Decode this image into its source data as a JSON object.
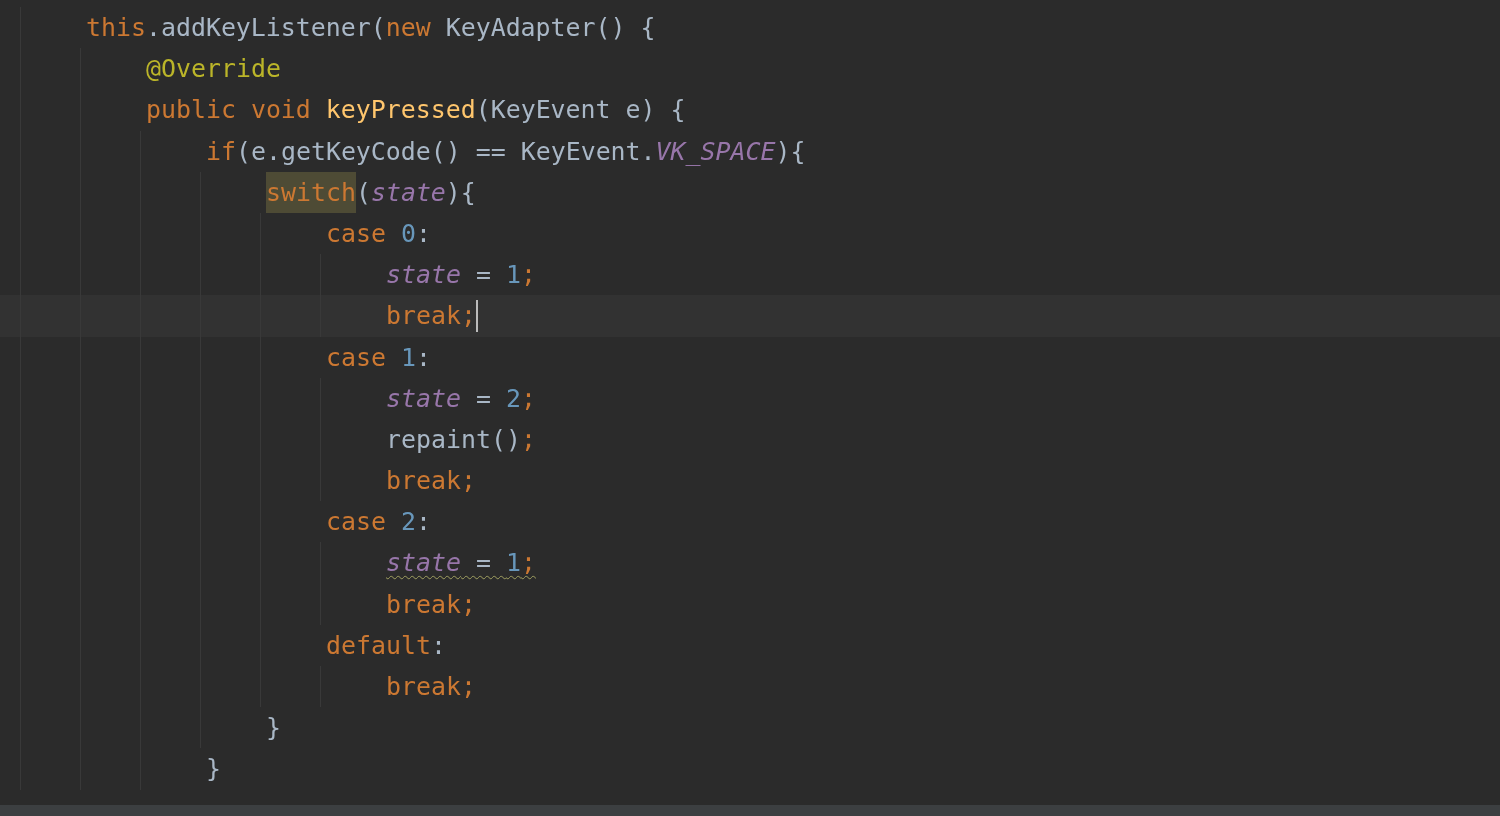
{
  "editor": {
    "lines": [
      {
        "current": false,
        "warning": false,
        "tokens": [
          {
            "kind": "keyword",
            "text": "this"
          },
          {
            "kind": "plain",
            "text": ".addKeyListener("
          },
          {
            "kind": "keyword",
            "text": "new"
          },
          {
            "kind": "plain",
            "text": " KeyAdapter() {"
          }
        ],
        "children": [
          {
            "current": false,
            "warning": false,
            "tokens": [
              {
                "kind": "annotation",
                "text": "@Override"
              }
            ]
          },
          {
            "current": false,
            "warning": false,
            "tokens": [
              {
                "kind": "keyword",
                "text": "public void "
              },
              {
                "kind": "method",
                "text": "keyPressed"
              },
              {
                "kind": "plain",
                "text": "(KeyEvent e) {"
              }
            ],
            "children": [
              {
                "current": false,
                "warning": false,
                "tokens": [
                  {
                    "kind": "keyword",
                    "text": "if"
                  },
                  {
                    "kind": "plain",
                    "text": "(e.getKeyCode() == KeyEvent."
                  },
                  {
                    "kind": "constant",
                    "text": "VK_SPACE"
                  },
                  {
                    "kind": "plain",
                    "text": "){"
                  }
                ],
                "children": [
                  {
                    "current": false,
                    "warning": false,
                    "tokens": [
                      {
                        "kind": "match",
                        "text": "switch"
                      },
                      {
                        "kind": "plain",
                        "text": "("
                      },
                      {
                        "kind": "field",
                        "text": "state"
                      },
                      {
                        "kind": "plain",
                        "text": "){"
                      }
                    ],
                    "children": [
                      {
                        "current": false,
                        "warning": false,
                        "tokens": [
                          {
                            "kind": "keyword",
                            "text": "case "
                          },
                          {
                            "kind": "number",
                            "text": "0"
                          },
                          {
                            "kind": "plain",
                            "text": ":"
                          }
                        ],
                        "children": [
                          {
                            "current": false,
                            "warning": false,
                            "tokens": [
                              {
                                "kind": "field",
                                "text": "state"
                              },
                              {
                                "kind": "plain",
                                "text": " = "
                              },
                              {
                                "kind": "number",
                                "text": "1"
                              },
                              {
                                "kind": "keyword",
                                "text": ";"
                              }
                            ]
                          },
                          {
                            "current": true,
                            "warning": false,
                            "tokens": [
                              {
                                "kind": "keyword",
                                "text": "break;"
                              }
                            ]
                          }
                        ]
                      },
                      {
                        "current": false,
                        "warning": false,
                        "tokens": [
                          {
                            "kind": "keyword",
                            "text": "case "
                          },
                          {
                            "kind": "number",
                            "text": "1"
                          },
                          {
                            "kind": "plain",
                            "text": ":"
                          }
                        ],
                        "children": [
                          {
                            "current": false,
                            "warning": false,
                            "tokens": [
                              {
                                "kind": "field",
                                "text": "state"
                              },
                              {
                                "kind": "plain",
                                "text": " = "
                              },
                              {
                                "kind": "number",
                                "text": "2"
                              },
                              {
                                "kind": "keyword",
                                "text": ";"
                              }
                            ]
                          },
                          {
                            "current": false,
                            "warning": false,
                            "tokens": [
                              {
                                "kind": "plain",
                                "text": "repaint()"
                              },
                              {
                                "kind": "keyword",
                                "text": ";"
                              }
                            ]
                          },
                          {
                            "current": false,
                            "warning": false,
                            "tokens": [
                              {
                                "kind": "keyword",
                                "text": "break;"
                              }
                            ]
                          }
                        ]
                      },
                      {
                        "current": false,
                        "warning": false,
                        "tokens": [
                          {
                            "kind": "keyword",
                            "text": "case "
                          },
                          {
                            "kind": "number",
                            "text": "2"
                          },
                          {
                            "kind": "plain",
                            "text": ":"
                          }
                        ],
                        "children": [
                          {
                            "current": false,
                            "warning": true,
                            "tokens": [
                              {
                                "kind": "field",
                                "text": "state"
                              },
                              {
                                "kind": "plain",
                                "text": " = "
                              },
                              {
                                "kind": "number",
                                "text": "1"
                              },
                              {
                                "kind": "keyword",
                                "text": ";"
                              }
                            ]
                          },
                          {
                            "current": false,
                            "warning": false,
                            "tokens": [
                              {
                                "kind": "keyword",
                                "text": "break;"
                              }
                            ]
                          }
                        ]
                      },
                      {
                        "current": false,
                        "warning": false,
                        "tokens": [
                          {
                            "kind": "keyword",
                            "text": "default"
                          },
                          {
                            "kind": "plain",
                            "text": ":"
                          }
                        ],
                        "children": [
                          {
                            "current": false,
                            "warning": false,
                            "tokens": [
                              {
                                "kind": "keyword",
                                "text": "break;"
                              }
                            ]
                          }
                        ]
                      }
                    ]
                  },
                  {
                    "current": false,
                    "warning": false,
                    "tokens": [
                      {
                        "kind": "plain",
                        "text": "}"
                      }
                    ]
                  }
                ]
              },
              {
                "current": false,
                "warning": false,
                "tokens": [
                  {
                    "kind": "plain",
                    "text": "}"
                  }
                ]
              }
            ]
          }
        ]
      }
    ]
  }
}
